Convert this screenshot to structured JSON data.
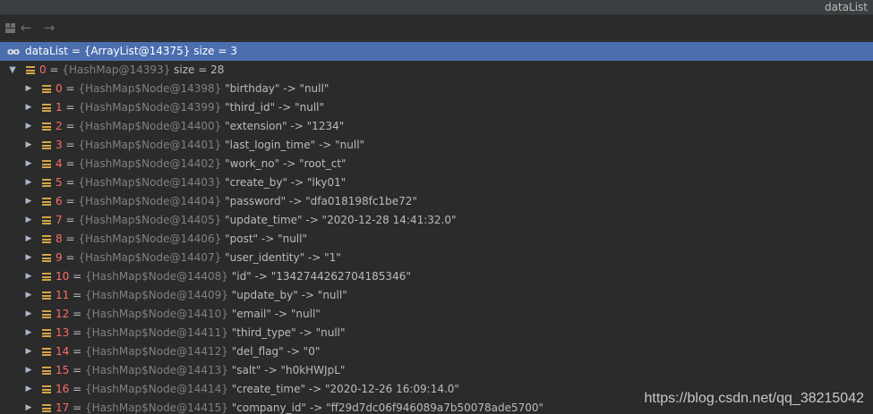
{
  "window": {
    "title": "dataList"
  },
  "toolbar": {
    "layout_icon": "layout-icon",
    "back_icon": "arrow-left-icon",
    "forward_icon": "arrow-right-icon",
    "back_glyph": "←",
    "forward_glyph": "→"
  },
  "root": {
    "icon_glyph": "oo",
    "name": "dataList",
    "eq": " = ",
    "ref": "{ArrayList@14375}",
    "size": "  size = 3"
  },
  "item0": {
    "arrow": "▼",
    "index": "0",
    "eq": " = ",
    "ref": "{HashMap@14393}",
    "size": "  size = 28"
  },
  "entries": [
    {
      "index": "0",
      "ref": "{HashMap$Node@14398}",
      "value": " \"birthday\" -> \"null\""
    },
    {
      "index": "1",
      "ref": "{HashMap$Node@14399}",
      "value": " \"third_id\" -> \"null\""
    },
    {
      "index": "2",
      "ref": "{HashMap$Node@14400}",
      "value": " \"extension\" -> \"1234\""
    },
    {
      "index": "3",
      "ref": "{HashMap$Node@14401}",
      "value": " \"last_login_time\" -> \"null\""
    },
    {
      "index": "4",
      "ref": "{HashMap$Node@14402}",
      "value": " \"work_no\" -> \"root_ct\""
    },
    {
      "index": "5",
      "ref": "{HashMap$Node@14403}",
      "value": " \"create_by\" -> \"lky01\""
    },
    {
      "index": "6",
      "ref": "{HashMap$Node@14404}",
      "value": " \"password\" -> \"dfa018198fc1be72\""
    },
    {
      "index": "7",
      "ref": "{HashMap$Node@14405}",
      "value": " \"update_time\" -> \"2020-12-28 14:41:32.0\""
    },
    {
      "index": "8",
      "ref": "{HashMap$Node@14406}",
      "value": " \"post\" -> \"null\""
    },
    {
      "index": "9",
      "ref": "{HashMap$Node@14407}",
      "value": " \"user_identity\" -> \"1\""
    },
    {
      "index": "10",
      "ref": "{HashMap$Node@14408}",
      "value": " \"id\" -> \"1342744262704185346\""
    },
    {
      "index": "11",
      "ref": "{HashMap$Node@14409}",
      "value": " \"update_by\" -> \"null\""
    },
    {
      "index": "12",
      "ref": "{HashMap$Node@14410}",
      "value": " \"email\" -> \"null\""
    },
    {
      "index": "13",
      "ref": "{HashMap$Node@14411}",
      "value": " \"third_type\" -> \"null\""
    },
    {
      "index": "14",
      "ref": "{HashMap$Node@14412}",
      "value": " \"del_flag\" -> \"0\""
    },
    {
      "index": "15",
      "ref": "{HashMap$Node@14413}",
      "value": " \"salt\" -> \"h0kHWJpL\""
    },
    {
      "index": "16",
      "ref": "{HashMap$Node@14414}",
      "value": " \"create_time\" -> \"2020-12-26 16:09:14.0\""
    },
    {
      "index": "17",
      "ref": "{HashMap$Node@14415}",
      "value": " \"company_id\" -> \"ff29d7dc06f946089a7b50078ade5700\""
    }
  ],
  "entry_eq": " = ",
  "entry_arrow": "▶",
  "watermark": "https://blog.csdn.net/qq_38215042",
  "colors": {
    "background": "#2b2b2b",
    "selection": "#4b6eaf",
    "key": "#ff6b68",
    "reference": "#808080",
    "field_icon": "#d5a548"
  }
}
